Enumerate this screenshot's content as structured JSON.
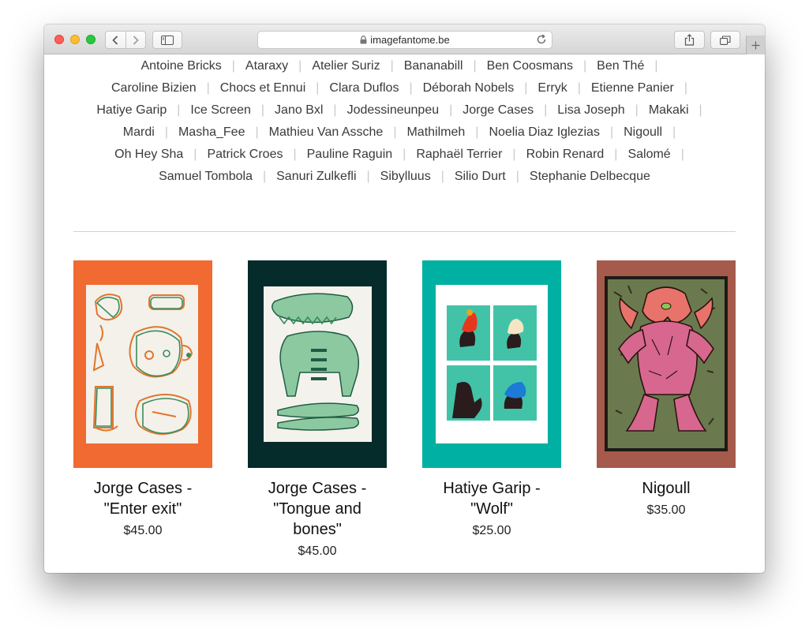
{
  "browser": {
    "url": "imagefantome.be"
  },
  "artists_rows": [
    [
      "Antoine Bricks",
      "Ataraxy",
      "Atelier Suriz",
      "Bananabill",
      "Ben Coosmans",
      "Ben Thé"
    ],
    [
      "Caroline Bizien",
      "Chocs et Ennui",
      "Clara Duflos",
      "Déborah Nobels",
      "Erryk",
      "Etienne Panier"
    ],
    [
      "Hatiye Garip",
      "Ice Screen",
      "Jano Bxl",
      "Jodessineunpeu",
      "Jorge Cases",
      "Lisa Joseph",
      "Makaki"
    ],
    [
      "Mardi",
      "Masha_Fee",
      "Mathieu Van Assche",
      "Mathilmeh",
      "Noelia Diaz Iglezias",
      "Nigoull"
    ],
    [
      "Oh Hey Sha",
      "Patrick Croes",
      "Pauline Raguin",
      "Raphaël Terrier",
      "Robin Renard",
      "Salomé"
    ],
    [
      "Samuel Tombola",
      "Sanuri Zulkefli",
      "Sibylluus",
      "Silio Durt",
      "Stephanie Delbecque"
    ]
  ],
  "separator": "|",
  "products": [
    {
      "title_lines": [
        "Jorge Cases -",
        "\"Enter exit\""
      ],
      "price": "$45.00",
      "bg": "#f06a31",
      "art": "orange"
    },
    {
      "title_lines": [
        "Jorge Cases -",
        "\"Tongue and",
        "bones\""
      ],
      "price": "$45.00",
      "bg": "#052b2b",
      "art": "dark"
    },
    {
      "title_lines": [
        "Hatiye Garip -",
        "\"Wolf\""
      ],
      "price": "$25.00",
      "bg": "#00b0a2",
      "art": "teal"
    },
    {
      "title_lines": [
        "Nigoull"
      ],
      "price": "$35.00",
      "bg": "#a65a4b",
      "art": "rust"
    }
  ]
}
